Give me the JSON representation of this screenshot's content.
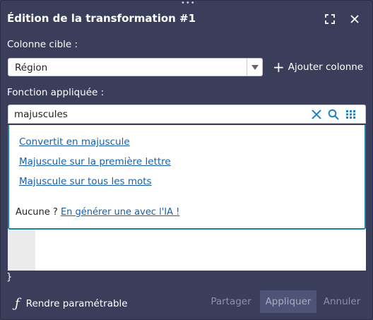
{
  "dialog": {
    "title": "Édition de la transformation #1",
    "grip": "•••",
    "expand_icon": "expand-icon",
    "close_icon": "close-icon"
  },
  "target": {
    "label": "Colonne cible :",
    "selected": "Région",
    "add_column_label": "Ajouter colonne"
  },
  "function": {
    "label": "Fonction appliquée :",
    "search_value": "majuscules",
    "options": [
      "Convertit en majuscule",
      "Majuscule sur la première lettre",
      "Majuscule sur tous les mots"
    ],
    "none_prefix": "Aucune ?",
    "generate_link": "En générer une avec l'IA !"
  },
  "editor": {
    "closing_brace": "}"
  },
  "footer": {
    "parametrable_label": "Rendre paramétrable",
    "share_label": "Partager",
    "apply_label": "Appliquer",
    "cancel_label": "Annuler"
  },
  "colors": {
    "dialog_bg": "#3b3e5a",
    "accent_border": "#1e82a8",
    "link": "#1a5ea8",
    "icon_blue": "#1e82c8"
  }
}
